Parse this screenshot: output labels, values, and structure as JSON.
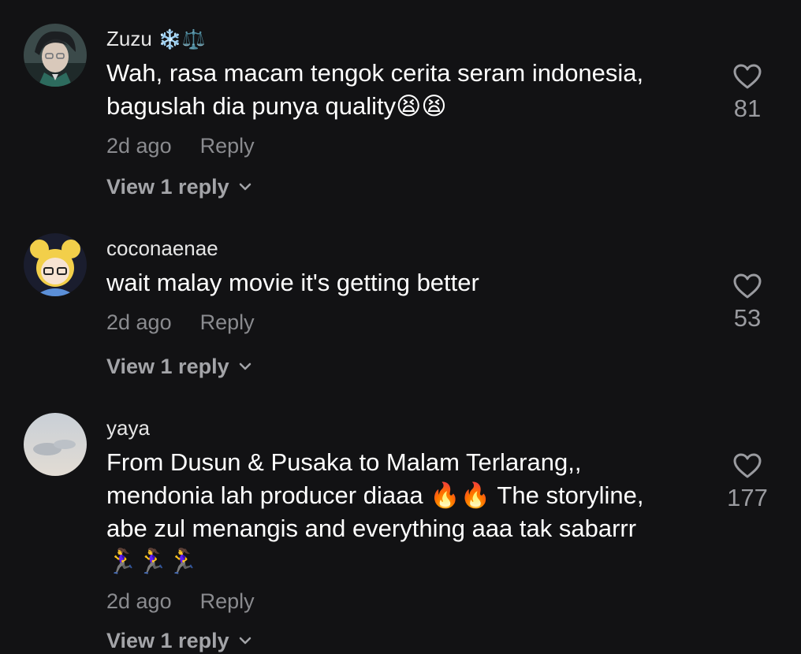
{
  "comments": [
    {
      "username": "Zuzu",
      "badges": "❄️⚖️",
      "text": "Wah, rasa macam tengok cerita seram indonesia,\nbaguslah dia punya quality😫😫",
      "time": "2d ago",
      "reply_label": "Reply",
      "view_replies": "View 1 reply",
      "likes": "81"
    },
    {
      "username": "coconaenae",
      "badges": "",
      "text": "wait malay movie it's getting better",
      "time": "2d ago",
      "reply_label": "Reply",
      "view_replies": "View 1 reply",
      "likes": "53"
    },
    {
      "username": "yaya",
      "badges": "",
      "text": "From Dusun & Pusaka to Malam Terlarang,,\nmendonia lah producer diaaa 🔥🔥 The storyline,\nabe zul menangis and everything aaa tak sabarrr\n🏃‍♀️🏃‍♀️🏃‍♀️",
      "time": "2d ago",
      "reply_label": "Reply",
      "view_replies": "View 1 reply",
      "likes": "177"
    }
  ],
  "icons": {
    "like": "heart-outline-icon",
    "expand": "chevron-down-icon"
  },
  "colors": {
    "background": "#121214",
    "primary_text": "#ffffff",
    "secondary_text": "#8a8b8f"
  }
}
